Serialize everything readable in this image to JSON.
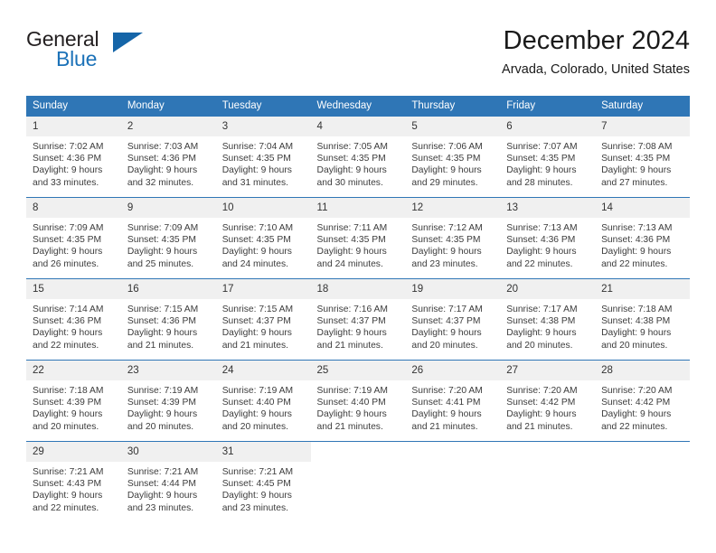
{
  "brand": {
    "name_part1": "General",
    "name_part2": "Blue",
    "triangle_color": "#1565a8",
    "blue_color": "#1c72b8"
  },
  "header": {
    "title": "December 2024",
    "subtitle": "Arvada, Colorado, United States"
  },
  "theme": {
    "header_bg": "#2f76b6",
    "daynum_bg": "#f0f0f0",
    "text_color": "#3c3c3c"
  },
  "weekdays": [
    "Sunday",
    "Monday",
    "Tuesday",
    "Wednesday",
    "Thursday",
    "Friday",
    "Saturday"
  ],
  "weeks": [
    [
      {
        "day": "1",
        "sunrise": "Sunrise: 7:02 AM",
        "sunset": "Sunset: 4:36 PM",
        "daylight1": "Daylight: 9 hours",
        "daylight2": "and 33 minutes."
      },
      {
        "day": "2",
        "sunrise": "Sunrise: 7:03 AM",
        "sunset": "Sunset: 4:36 PM",
        "daylight1": "Daylight: 9 hours",
        "daylight2": "and 32 minutes."
      },
      {
        "day": "3",
        "sunrise": "Sunrise: 7:04 AM",
        "sunset": "Sunset: 4:35 PM",
        "daylight1": "Daylight: 9 hours",
        "daylight2": "and 31 minutes."
      },
      {
        "day": "4",
        "sunrise": "Sunrise: 7:05 AM",
        "sunset": "Sunset: 4:35 PM",
        "daylight1": "Daylight: 9 hours",
        "daylight2": "and 30 minutes."
      },
      {
        "day": "5",
        "sunrise": "Sunrise: 7:06 AM",
        "sunset": "Sunset: 4:35 PM",
        "daylight1": "Daylight: 9 hours",
        "daylight2": "and 29 minutes."
      },
      {
        "day": "6",
        "sunrise": "Sunrise: 7:07 AM",
        "sunset": "Sunset: 4:35 PM",
        "daylight1": "Daylight: 9 hours",
        "daylight2": "and 28 minutes."
      },
      {
        "day": "7",
        "sunrise": "Sunrise: 7:08 AM",
        "sunset": "Sunset: 4:35 PM",
        "daylight1": "Daylight: 9 hours",
        "daylight2": "and 27 minutes."
      }
    ],
    [
      {
        "day": "8",
        "sunrise": "Sunrise: 7:09 AM",
        "sunset": "Sunset: 4:35 PM",
        "daylight1": "Daylight: 9 hours",
        "daylight2": "and 26 minutes."
      },
      {
        "day": "9",
        "sunrise": "Sunrise: 7:09 AM",
        "sunset": "Sunset: 4:35 PM",
        "daylight1": "Daylight: 9 hours",
        "daylight2": "and 25 minutes."
      },
      {
        "day": "10",
        "sunrise": "Sunrise: 7:10 AM",
        "sunset": "Sunset: 4:35 PM",
        "daylight1": "Daylight: 9 hours",
        "daylight2": "and 24 minutes."
      },
      {
        "day": "11",
        "sunrise": "Sunrise: 7:11 AM",
        "sunset": "Sunset: 4:35 PM",
        "daylight1": "Daylight: 9 hours",
        "daylight2": "and 24 minutes."
      },
      {
        "day": "12",
        "sunrise": "Sunrise: 7:12 AM",
        "sunset": "Sunset: 4:35 PM",
        "daylight1": "Daylight: 9 hours",
        "daylight2": "and 23 minutes."
      },
      {
        "day": "13",
        "sunrise": "Sunrise: 7:13 AM",
        "sunset": "Sunset: 4:36 PM",
        "daylight1": "Daylight: 9 hours",
        "daylight2": "and 22 minutes."
      },
      {
        "day": "14",
        "sunrise": "Sunrise: 7:13 AM",
        "sunset": "Sunset: 4:36 PM",
        "daylight1": "Daylight: 9 hours",
        "daylight2": "and 22 minutes."
      }
    ],
    [
      {
        "day": "15",
        "sunrise": "Sunrise: 7:14 AM",
        "sunset": "Sunset: 4:36 PM",
        "daylight1": "Daylight: 9 hours",
        "daylight2": "and 22 minutes."
      },
      {
        "day": "16",
        "sunrise": "Sunrise: 7:15 AM",
        "sunset": "Sunset: 4:36 PM",
        "daylight1": "Daylight: 9 hours",
        "daylight2": "and 21 minutes."
      },
      {
        "day": "17",
        "sunrise": "Sunrise: 7:15 AM",
        "sunset": "Sunset: 4:37 PM",
        "daylight1": "Daylight: 9 hours",
        "daylight2": "and 21 minutes."
      },
      {
        "day": "18",
        "sunrise": "Sunrise: 7:16 AM",
        "sunset": "Sunset: 4:37 PM",
        "daylight1": "Daylight: 9 hours",
        "daylight2": "and 21 minutes."
      },
      {
        "day": "19",
        "sunrise": "Sunrise: 7:17 AM",
        "sunset": "Sunset: 4:37 PM",
        "daylight1": "Daylight: 9 hours",
        "daylight2": "and 20 minutes."
      },
      {
        "day": "20",
        "sunrise": "Sunrise: 7:17 AM",
        "sunset": "Sunset: 4:38 PM",
        "daylight1": "Daylight: 9 hours",
        "daylight2": "and 20 minutes."
      },
      {
        "day": "21",
        "sunrise": "Sunrise: 7:18 AM",
        "sunset": "Sunset: 4:38 PM",
        "daylight1": "Daylight: 9 hours",
        "daylight2": "and 20 minutes."
      }
    ],
    [
      {
        "day": "22",
        "sunrise": "Sunrise: 7:18 AM",
        "sunset": "Sunset: 4:39 PM",
        "daylight1": "Daylight: 9 hours",
        "daylight2": "and 20 minutes."
      },
      {
        "day": "23",
        "sunrise": "Sunrise: 7:19 AM",
        "sunset": "Sunset: 4:39 PM",
        "daylight1": "Daylight: 9 hours",
        "daylight2": "and 20 minutes."
      },
      {
        "day": "24",
        "sunrise": "Sunrise: 7:19 AM",
        "sunset": "Sunset: 4:40 PM",
        "daylight1": "Daylight: 9 hours",
        "daylight2": "and 20 minutes."
      },
      {
        "day": "25",
        "sunrise": "Sunrise: 7:19 AM",
        "sunset": "Sunset: 4:40 PM",
        "daylight1": "Daylight: 9 hours",
        "daylight2": "and 21 minutes."
      },
      {
        "day": "26",
        "sunrise": "Sunrise: 7:20 AM",
        "sunset": "Sunset: 4:41 PM",
        "daylight1": "Daylight: 9 hours",
        "daylight2": "and 21 minutes."
      },
      {
        "day": "27",
        "sunrise": "Sunrise: 7:20 AM",
        "sunset": "Sunset: 4:42 PM",
        "daylight1": "Daylight: 9 hours",
        "daylight2": "and 21 minutes."
      },
      {
        "day": "28",
        "sunrise": "Sunrise: 7:20 AM",
        "sunset": "Sunset: 4:42 PM",
        "daylight1": "Daylight: 9 hours",
        "daylight2": "and 22 minutes."
      }
    ],
    [
      {
        "day": "29",
        "sunrise": "Sunrise: 7:21 AM",
        "sunset": "Sunset: 4:43 PM",
        "daylight1": "Daylight: 9 hours",
        "daylight2": "and 22 minutes."
      },
      {
        "day": "30",
        "sunrise": "Sunrise: 7:21 AM",
        "sunset": "Sunset: 4:44 PM",
        "daylight1": "Daylight: 9 hours",
        "daylight2": "and 23 minutes."
      },
      {
        "day": "31",
        "sunrise": "Sunrise: 7:21 AM",
        "sunset": "Sunset: 4:45 PM",
        "daylight1": "Daylight: 9 hours",
        "daylight2": "and 23 minutes."
      },
      {
        "day": "",
        "sunrise": "",
        "sunset": "",
        "daylight1": "",
        "daylight2": ""
      },
      {
        "day": "",
        "sunrise": "",
        "sunset": "",
        "daylight1": "",
        "daylight2": ""
      },
      {
        "day": "",
        "sunrise": "",
        "sunset": "",
        "daylight1": "",
        "daylight2": ""
      },
      {
        "day": "",
        "sunrise": "",
        "sunset": "",
        "daylight1": "",
        "daylight2": ""
      }
    ]
  ]
}
